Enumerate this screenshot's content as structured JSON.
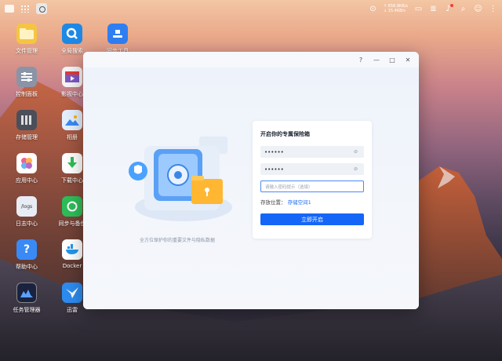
{
  "taskbar": {
    "net_up": "↑ 656.8KB/s",
    "net_down": "↓ 15.4KB/s"
  },
  "desktop": {
    "icons": [
      {
        "label": "文件管理",
        "color": "#f5c542"
      },
      {
        "label": "全局搜索",
        "color": "#1e88e5"
      },
      {
        "label": "同步工具",
        "color": "#2f7ff3"
      },
      {
        "label": "控制面板",
        "color": "#8a94a6"
      },
      {
        "label": "影视中心",
        "color": "#f5f5f5"
      },
      {
        "label": "存储管理",
        "color": "#4a4f5a"
      },
      {
        "label": "相册",
        "color": "#e3f0ff"
      },
      {
        "label": "应用中心",
        "color": "#ffffff"
      },
      {
        "label": "下载中心",
        "color": "#ffffff"
      },
      {
        "label": "日志中心",
        "color": "#e8edf5"
      },
      {
        "label": "同步与备份",
        "color": "#2ebd59"
      },
      {
        "label": "帮助中心",
        "color": "#3a8af5"
      },
      {
        "label": "Docker",
        "color": "#ffffff"
      },
      {
        "label": "任务管理器",
        "color": "#1a2240"
      },
      {
        "label": "迅雷",
        "color": "#2d8cf0"
      }
    ],
    "logs_text": "/logs"
  },
  "window": {
    "controls": [
      "?",
      "—",
      "□",
      "✕"
    ],
    "caption": "全方位保护你的重要文件与隐私数据",
    "form": {
      "title": "开启你的专属保险箱",
      "password_mask": "••••••",
      "confirm_mask": "••••••",
      "hint_placeholder": "请输入密码提示（选填）",
      "location_label": "存放位置：",
      "location_value": "存储空间1",
      "submit": "立即开启"
    }
  },
  "colors": {
    "accent": "#1566f7",
    "link": "#1e6cf2"
  }
}
